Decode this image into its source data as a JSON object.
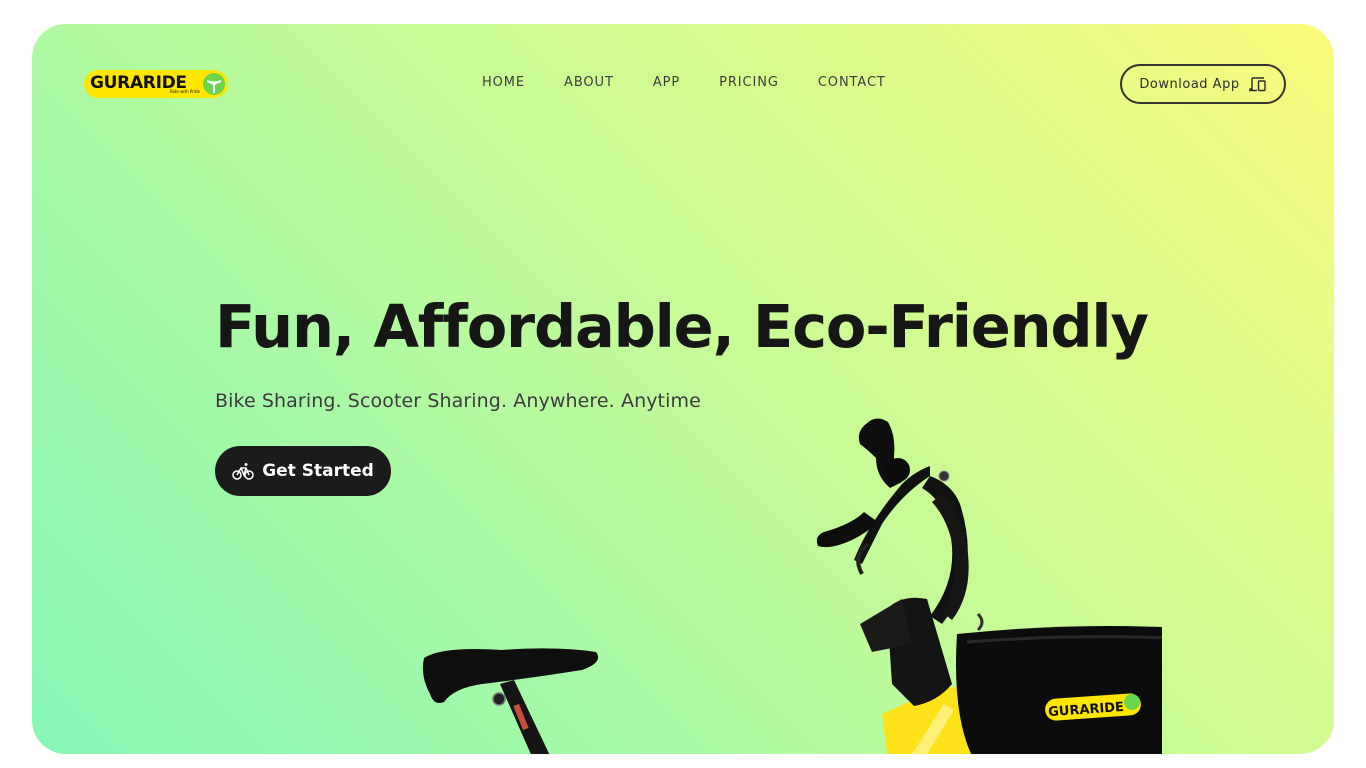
{
  "brand": {
    "name": "GURARIDE",
    "tagline": "Ride with Pride",
    "logo_color": "#ffe600"
  },
  "nav": {
    "items": [
      {
        "label": "HOME"
      },
      {
        "label": "ABOUT"
      },
      {
        "label": "APP"
      },
      {
        "label": "PRICING"
      },
      {
        "label": "CONTACT"
      }
    ]
  },
  "header": {
    "download_label": "Download App",
    "download_icon": "devices-icon"
  },
  "hero": {
    "headline": "Fun, Affordable, Eco-Friendly",
    "subheadline": "Bike Sharing. Scooter Sharing. Anywhere. Anytime",
    "cta_label": "Get Started",
    "cta_icon": "bicycle-icon",
    "gradient_colors": [
      "#fbfa7c",
      "#c8fb96",
      "#86f7b6"
    ],
    "image_alt": "Yellow and black GURARIDE scooter with basket"
  }
}
